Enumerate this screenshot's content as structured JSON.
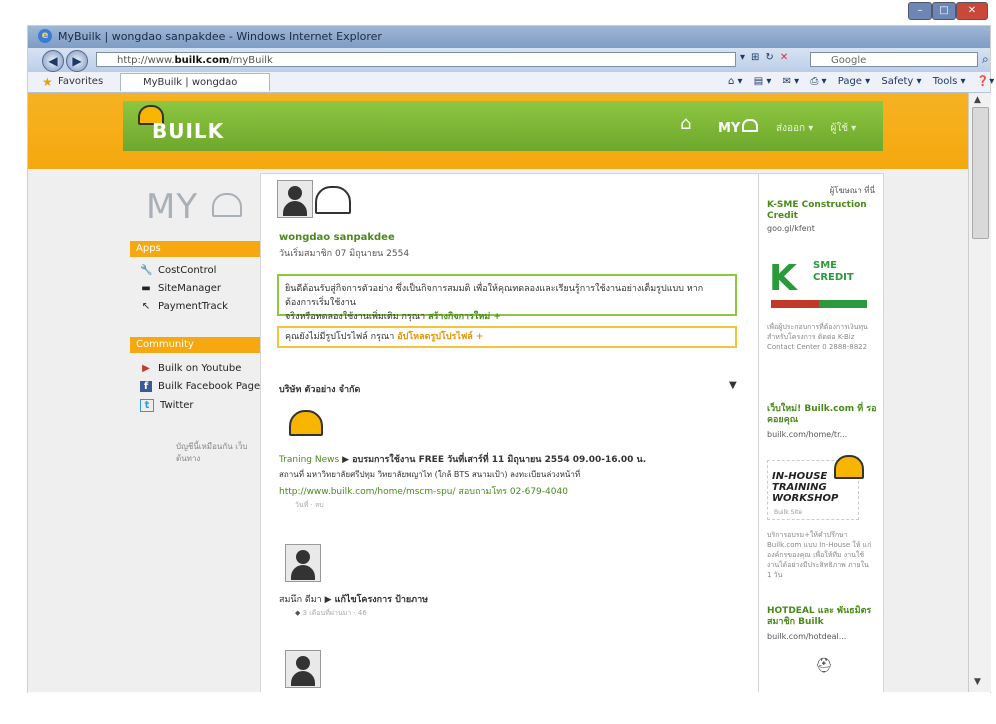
{
  "window": {
    "title": "MyBuilk | wongdao sanpakdee - Windows Internet Explorer",
    "url_prefix": "http://www.",
    "url_host": "builk.com",
    "url_path": "/myBuilk",
    "search_placeholder": "Google",
    "controls": {
      "minimize": "–",
      "maximize": "□",
      "close": "✕"
    }
  },
  "favorites": {
    "label": "Favorites",
    "tab_title": "MyBuilk | wongdao sanpakdee",
    "command_bar": [
      "Page ▾",
      "Safety ▾",
      "Tools ▾",
      "❓▾"
    ]
  },
  "banner": {
    "logo": "BUILK",
    "my": "MY",
    "menu": [
      "ส่งออก ▾",
      "ผู้ใช้ ▾"
    ]
  },
  "sidebar": {
    "my_logo": "MY",
    "apps_header": "Apps",
    "apps": [
      {
        "icon": "costcontrol-icon",
        "glyph": "🔧",
        "label": "CostControl"
      },
      {
        "icon": "sitemanager-icon",
        "glyph": "▬",
        "label": "SiteManager"
      },
      {
        "icon": "paymenttrack-icon",
        "glyph": "↖",
        "label": "PaymentTrack"
      }
    ],
    "community_header": "Community",
    "community": [
      {
        "icon": "youtube-icon",
        "glyph": "▶",
        "label": "Builk on Youtube"
      },
      {
        "icon": "facebook-icon",
        "glyph": "f",
        "label": "Builk Facebook Page"
      },
      {
        "icon": "twitter-icon",
        "glyph": "t",
        "label": "Twitter"
      }
    ],
    "note": "บัญชีนี้เหมือนกัน เว็บต้นทาง"
  },
  "profile": {
    "name": "wongdao sanpakdee",
    "joined": "วันเริ่มสมาชิก 07 มิถุนายน 2554",
    "welcome_text": "ยินดีต้อนรับสู่กิจการตัวอย่าง ซึ่งเป็นกิจการสมมติ เพื่อให้คุณทดลองและเรียนรู้การใช้งานอย่างเต็มรูปแบบ หากต้องการเริ่มใช้งาน",
    "welcome_text2": "จริงหรือทดลองใช้งานเพิ่มเติม กรุณา",
    "welcome_link": "สร้างกิจการใหม่ +",
    "profile_notice": "คุณยังไม่มีรูปโปรไฟล์ กรุณา",
    "profile_link": "อัปโหลดรูปโปรไฟล์ +"
  },
  "feed": {
    "company": "บริษัท ตัวอย่าง จำกัด",
    "dropdown": "▼",
    "items": [
      {
        "source": "Traning News",
        "headline": "▶ อบรมการใช้งาน FREE วันที่เสาร์ที่ 11 มิถุนายน 2554 09.00-16.00 น.",
        "detail": "สถานที่ มหาวิทยาลัยศรีปทุม วิทยาลัยพญาไท (ใกล้ BTS สนามเป้า) ลงทะเบียนล่วงหน้าที่",
        "url": "http://www.builk.com/home/mscm-spu/ สอบถามโทร 02-679-4040",
        "meta": "วันที่ · ลบ"
      },
      {
        "source": "สมนึก ดีมา",
        "headline": "▶ แก้ไขโครงการ ป้ายภาษ",
        "meta": "3 เดือนที่ผ่านมา · 46"
      }
    ]
  },
  "sponsored": {
    "header": "ผู้โฆษณา ที่นี่",
    "ads": [
      {
        "title": "K-SME Construction Credit",
        "link": "goo.gl/kfent"
      },
      {
        "text": "เพื่อผู้ประกอบการที่ต้องการเงินทุน สำหรับโครงการ ติดต่อ K-Biz Contact Center 0 2888-8822"
      },
      {
        "title": "เว็บใหม่! Builk.com ที่ รอคอยคุณ",
        "link": "builk.com/home/tr..."
      },
      {
        "text": "บริการอบรม+ให้คำปรึกษา Builk.com แบบ In-House ให้ แก่องค์กรของคุณ เพื่อให้ทีม งานใช้งานได้อย่างมีประสิทธิภาพ ภายใน 1 วัน"
      },
      {
        "title": "HOTDEAL และ พันธมิตร สมาชิก Builk",
        "link": "builk.com/hotdeal..."
      }
    ],
    "sme_logo_text": "SME CREDIT",
    "sme_k": "K",
    "workshop_text": "IN-HOUSE TRAINING WORKSHOP",
    "workshop_sub": "Builk Site"
  },
  "colors": {
    "brand_orange": "#f5a80f",
    "brand_green": "#7ab834",
    "link_green": "#4a8a1c"
  }
}
